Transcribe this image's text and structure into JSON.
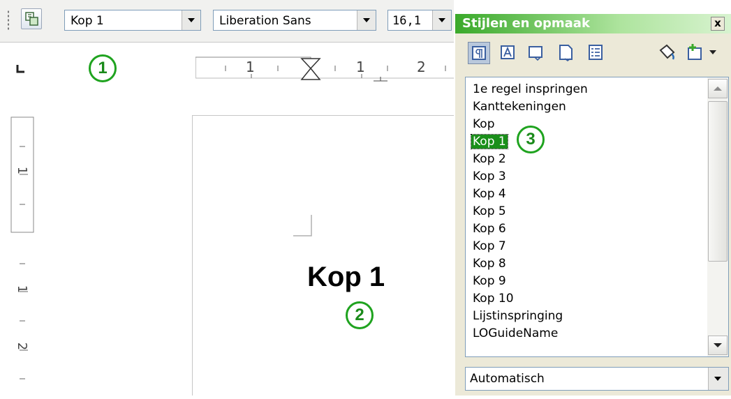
{
  "toolbar": {
    "paragraph_style": "Kop 1",
    "font_name": "Liberation Sans",
    "font_size": "16,1",
    "styles_button_icon": "styles-window-icon"
  },
  "ruler": {
    "h_numbers": [
      "1",
      "1",
      "2"
    ],
    "v_numbers": [
      "1",
      "1",
      "2"
    ]
  },
  "document": {
    "heading_text": "Kop 1"
  },
  "callouts": [
    "1",
    "2",
    "3"
  ],
  "styles_panel": {
    "title": "Stijlen en opmaak",
    "close_label": "x",
    "categories": [
      {
        "name": "paragraph-styles-icon",
        "selected": true
      },
      {
        "name": "character-styles-icon",
        "selected": false
      },
      {
        "name": "frame-styles-icon",
        "selected": false
      },
      {
        "name": "page-styles-icon",
        "selected": false
      },
      {
        "name": "list-styles-icon",
        "selected": false
      }
    ],
    "styles": [
      "1e regel inspringen",
      "Kanttekeningen",
      "Kop",
      "Kop 1",
      "Kop 2",
      "Kop 3",
      "Kop 4",
      "Kop 5",
      "Kop 6",
      "Kop 7",
      "Kop 8",
      "Kop 9",
      "Kop 10",
      "Lijstinspringing",
      "LOGuideName"
    ],
    "selected_style": "Kop 1",
    "filter": "Automatisch"
  },
  "colors": {
    "accent_green": "#1fa31f",
    "selection_green": "#1a8f1a"
  }
}
